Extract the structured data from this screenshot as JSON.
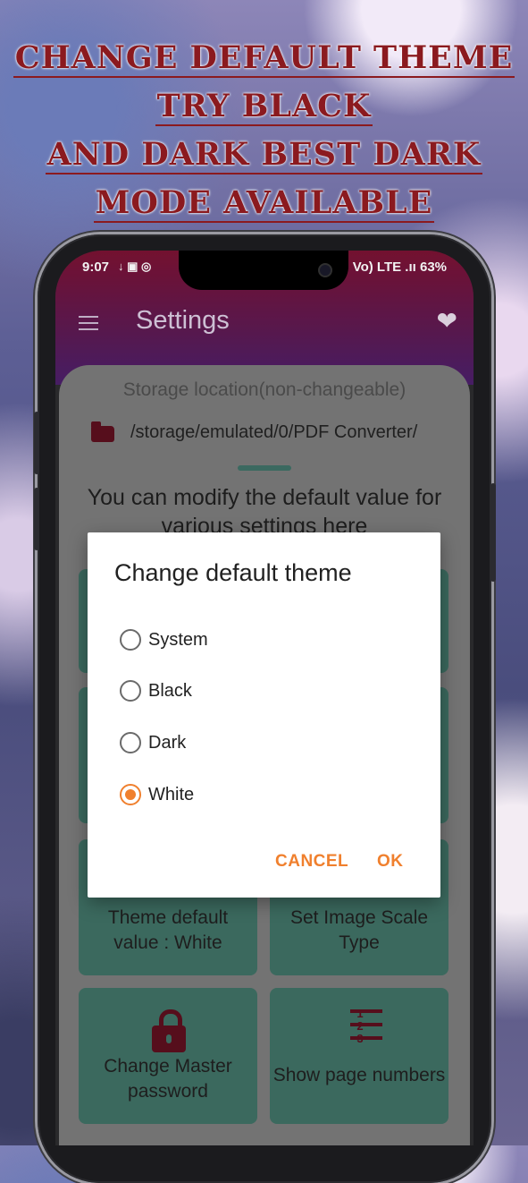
{
  "promo": {
    "line1": "CHANGE DEFAULT THEME",
    "line2": "TRY BLACK",
    "line3": "AND DARK BEST DARK",
    "line4": "MODE AVAILABLE"
  },
  "status_bar": {
    "time": "9:07",
    "left_icons": "↓ ▣ ◎",
    "right_text": "Vo) LTE .ıı 63%"
  },
  "app_bar": {
    "title": "Settings",
    "menu_icon": "hamburger-menu-icon",
    "favorite_icon": "heart-icon"
  },
  "settings": {
    "storage_label": "Storage location(non-changeable)",
    "storage_path": "/storage/emulated/0/PDF Converter/",
    "modify_text": "You can modify the default value for various settings here",
    "cards": [
      {
        "label": "Theme default value : White"
      },
      {
        "label": "Set Image Scale Type"
      },
      {
        "label": "Change Master password"
      },
      {
        "label": "Show page numbers"
      }
    ]
  },
  "dialog": {
    "title": "Change default theme",
    "options": [
      "System",
      "Black",
      "Dark",
      "White"
    ],
    "selected": "White",
    "cancel_label": "CANCEL",
    "ok_label": "OK"
  },
  "colors": {
    "accent": "#f0802e",
    "brand_maroon": "#8b1a1f",
    "card_teal": "#3f6f64"
  }
}
